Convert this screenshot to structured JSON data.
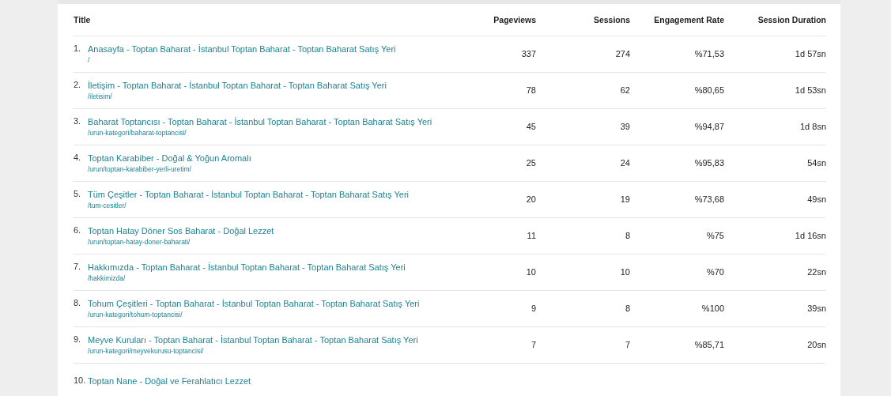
{
  "table": {
    "columns": [
      "Title",
      "Pageviews",
      "Sessions",
      "Engagement Rate",
      "Session Duration"
    ],
    "rows": [
      {
        "index": "1.",
        "title": "Anasayfa - Toptan Baharat - İstanbul Toptan Baharat - Toptan Baharat Satış Yeri",
        "path": "/",
        "pageviews": "337",
        "sessions": "274",
        "engagement_rate": "%71,53",
        "session_duration": "1d 57sn"
      },
      {
        "index": "2.",
        "title": "İletişim - Toptan Baharat - İstanbul Toptan Baharat - Toptan Baharat Satış Yeri",
        "path": "/iletisim/",
        "pageviews": "78",
        "sessions": "62",
        "engagement_rate": "%80,65",
        "session_duration": "1d 53sn"
      },
      {
        "index": "3.",
        "title": "Baharat Toptancısı - Toptan Baharat - İstanbul Toptan Baharat - Toptan Baharat Satış Yeri",
        "path": "/urun-kategori/baharat-toptancisi/",
        "pageviews": "45",
        "sessions": "39",
        "engagement_rate": "%94,87",
        "session_duration": "1d 8sn"
      },
      {
        "index": "4.",
        "title": "Toptan Karabiber - Doğal & Yoğun Aromalı",
        "path": "/urun/toptan-karabiber-yerli-uretim/",
        "pageviews": "25",
        "sessions": "24",
        "engagement_rate": "%95,83",
        "session_duration": "54sn"
      },
      {
        "index": "5.",
        "title": "Tüm Çeşitler - Toptan Baharat - İstanbul Toptan Baharat - Toptan Baharat Satış Yeri",
        "path": "/tum-cesitler/",
        "pageviews": "20",
        "sessions": "19",
        "engagement_rate": "%73,68",
        "session_duration": "49sn"
      },
      {
        "index": "6.",
        "title": "Toptan Hatay Döner Sos Baharat - Doğal Lezzet",
        "path": "/urun/toptan-hatay-doner-baharati/",
        "pageviews": "11",
        "sessions": "8",
        "engagement_rate": "%75",
        "session_duration": "1d 16sn"
      },
      {
        "index": "7.",
        "title": "Hakkımızda - Toptan Baharat - İstanbul Toptan Baharat - Toptan Baharat Satış Yeri",
        "path": "/hakkimizda/",
        "pageviews": "10",
        "sessions": "10",
        "engagement_rate": "%70",
        "session_duration": "22sn"
      },
      {
        "index": "8.",
        "title": "Tohum Çeşitleri - Toptan Baharat - İstanbul Toptan Baharat - Toptan Baharat Satış Yeri",
        "path": "/urun-kategori/tohum-toptancisi/",
        "pageviews": "9",
        "sessions": "8",
        "engagement_rate": "%100",
        "session_duration": "39sn"
      },
      {
        "index": "9.",
        "title": "Meyve Kuruları - Toptan Baharat - İstanbul Toptan Baharat - Toptan Baharat Satış Yeri",
        "path": "/urun-kategori/meyvekurusu-toptancisi/",
        "pageviews": "7",
        "sessions": "7",
        "engagement_rate": "%85,71",
        "session_duration": "20sn"
      },
      {
        "index": "10.",
        "title": "Toptan Nane - Doğal ve Ferahlatıcı Lezzet"
      }
    ]
  }
}
